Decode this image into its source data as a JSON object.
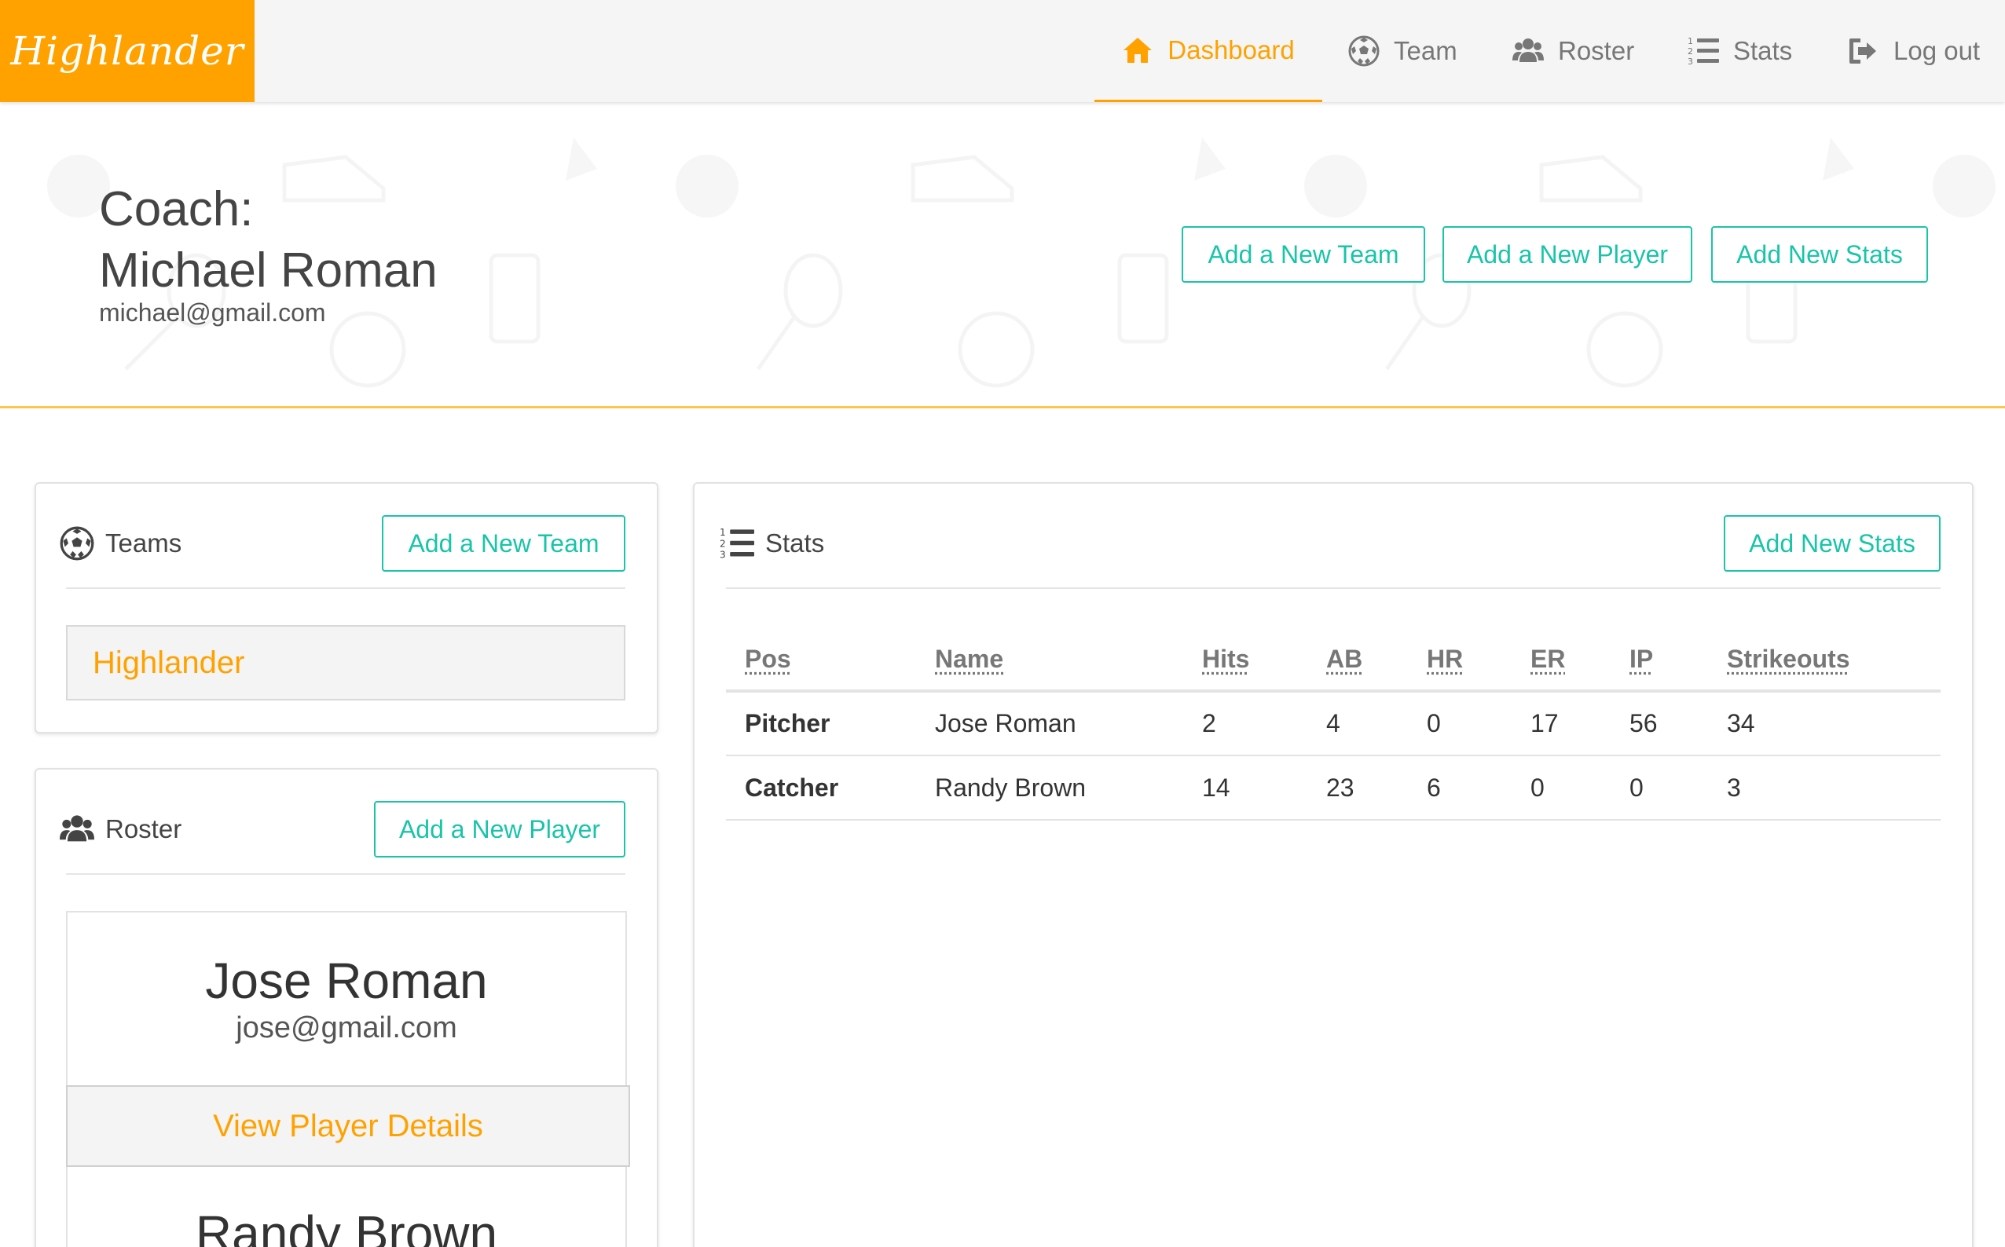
{
  "app": {
    "brand": "Highlander"
  },
  "nav": {
    "items": [
      {
        "label": "Dashboard",
        "icon": "home-icon",
        "active": true
      },
      {
        "label": "Team",
        "icon": "soccer-ball-icon",
        "active": false
      },
      {
        "label": "Roster",
        "icon": "users-icon",
        "active": false
      },
      {
        "label": "Stats",
        "icon": "numbered-list-icon",
        "active": false
      },
      {
        "label": "Log out",
        "icon": "sign-out-icon",
        "active": false
      }
    ]
  },
  "header": {
    "coach_label": "Coach:",
    "coach_name": "Michael Roman",
    "coach_email": "michael@gmail.com",
    "buttons": {
      "add_team": "Add a New Team",
      "add_player": "Add a New Player",
      "add_stats": "Add New Stats"
    }
  },
  "teams_panel": {
    "title": "Teams",
    "add_button": "Add a New Team",
    "teams": [
      "Highlander"
    ]
  },
  "roster_panel": {
    "title": "Roster",
    "add_button": "Add a New Player",
    "players": [
      {
        "name": "Jose Roman",
        "email": "jose@gmail.com",
        "details_button": "View Player Details"
      },
      {
        "name": "Randy Brown"
      }
    ]
  },
  "stats_panel": {
    "title": "Stats",
    "add_button": "Add New Stats",
    "columns": [
      "Pos",
      "Name",
      "Hits",
      "AB",
      "HR",
      "ER",
      "IP",
      "Strikeouts"
    ],
    "rows": [
      [
        "Pitcher",
        "Jose Roman",
        "2",
        "4",
        "0",
        "17",
        "56",
        "34"
      ],
      [
        "Catcher",
        "Randy Brown",
        "14",
        "23",
        "6",
        "0",
        "0",
        "3"
      ]
    ]
  },
  "colors": {
    "brand": "#ffa200",
    "accent": "#19c4a9",
    "navbar_bg": "#f5f5f5",
    "text": "#333333"
  }
}
